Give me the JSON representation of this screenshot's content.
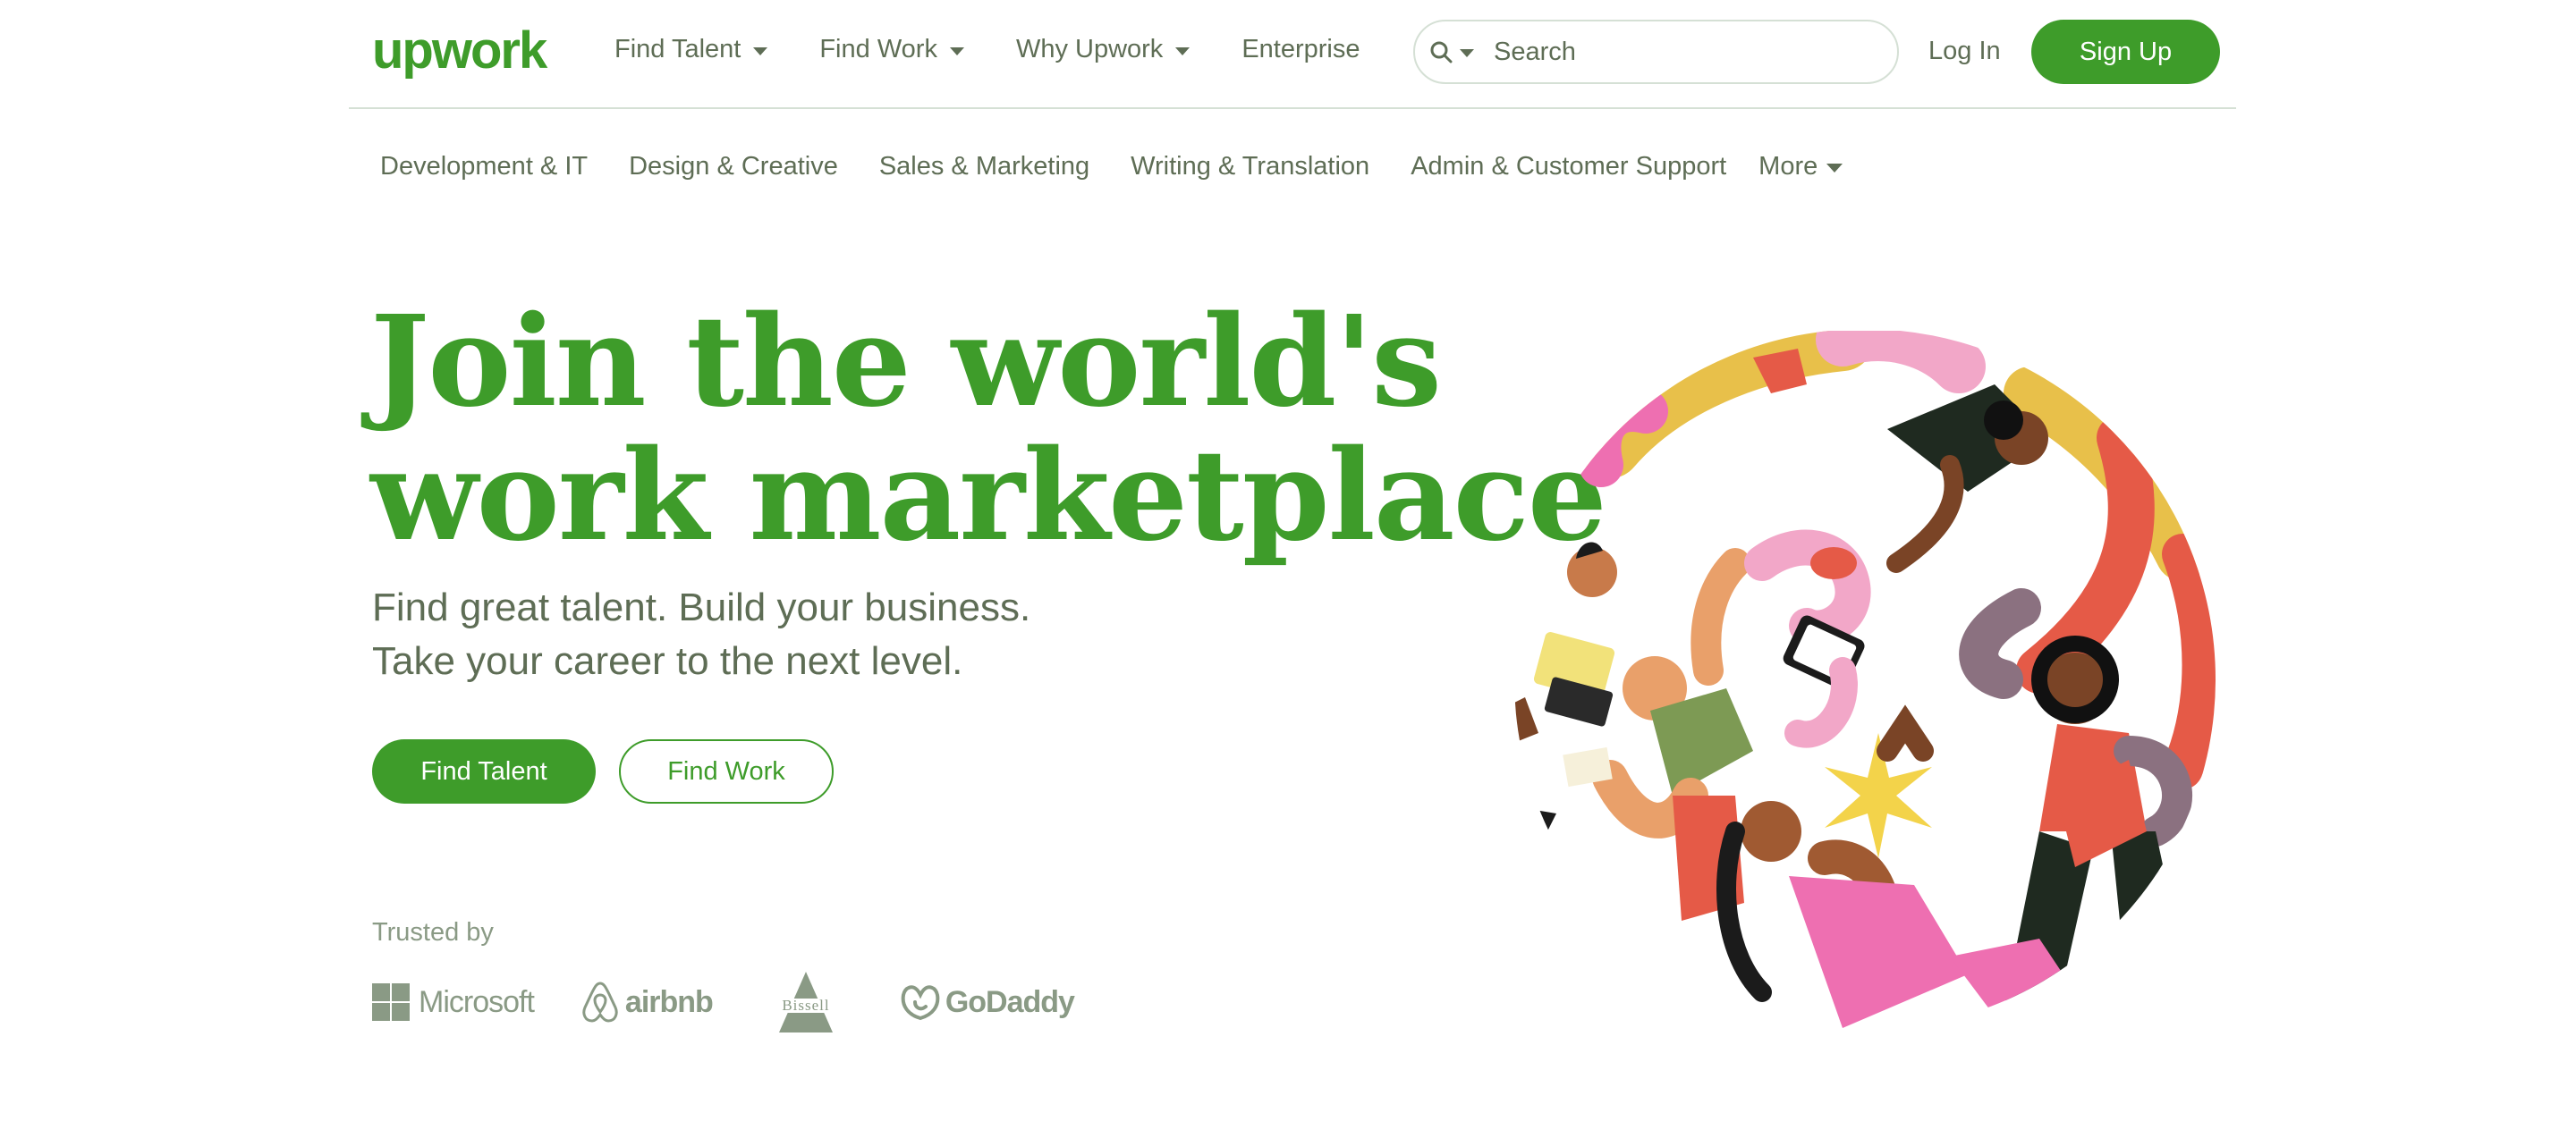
{
  "header": {
    "logo_text": "upwork",
    "nav": [
      {
        "label": "Find Talent",
        "has_dropdown": true
      },
      {
        "label": "Find Work",
        "has_dropdown": true
      },
      {
        "label": "Why Upwork",
        "has_dropdown": true
      },
      {
        "label": "Enterprise",
        "has_dropdown": false
      }
    ],
    "search": {
      "placeholder": "Search",
      "value": ""
    },
    "login_label": "Log In",
    "signup_label": "Sign Up"
  },
  "subnav": {
    "items": [
      "Development & IT",
      "Design & Creative",
      "Sales & Marketing",
      "Writing & Translation",
      "Admin & Customer Support"
    ],
    "more_label": "More"
  },
  "hero": {
    "title_line1": "Join the world's",
    "title_line2": "work marketplace",
    "subtitle_line1": "Find great talent. Build your business.",
    "subtitle_line2": "Take your career to the next level.",
    "primary_cta": "Find Talent",
    "secondary_cta": "Find Work"
  },
  "trusted": {
    "label": "Trusted by",
    "brands": [
      "Microsoft",
      "airbnb",
      "Bissell",
      "GoDaddy"
    ]
  },
  "colors": {
    "brand_green": "#3e9c2a",
    "muted_text": "#5e6d55",
    "logo_gray": "#8a9a85",
    "border": "#d5e0d5"
  }
}
